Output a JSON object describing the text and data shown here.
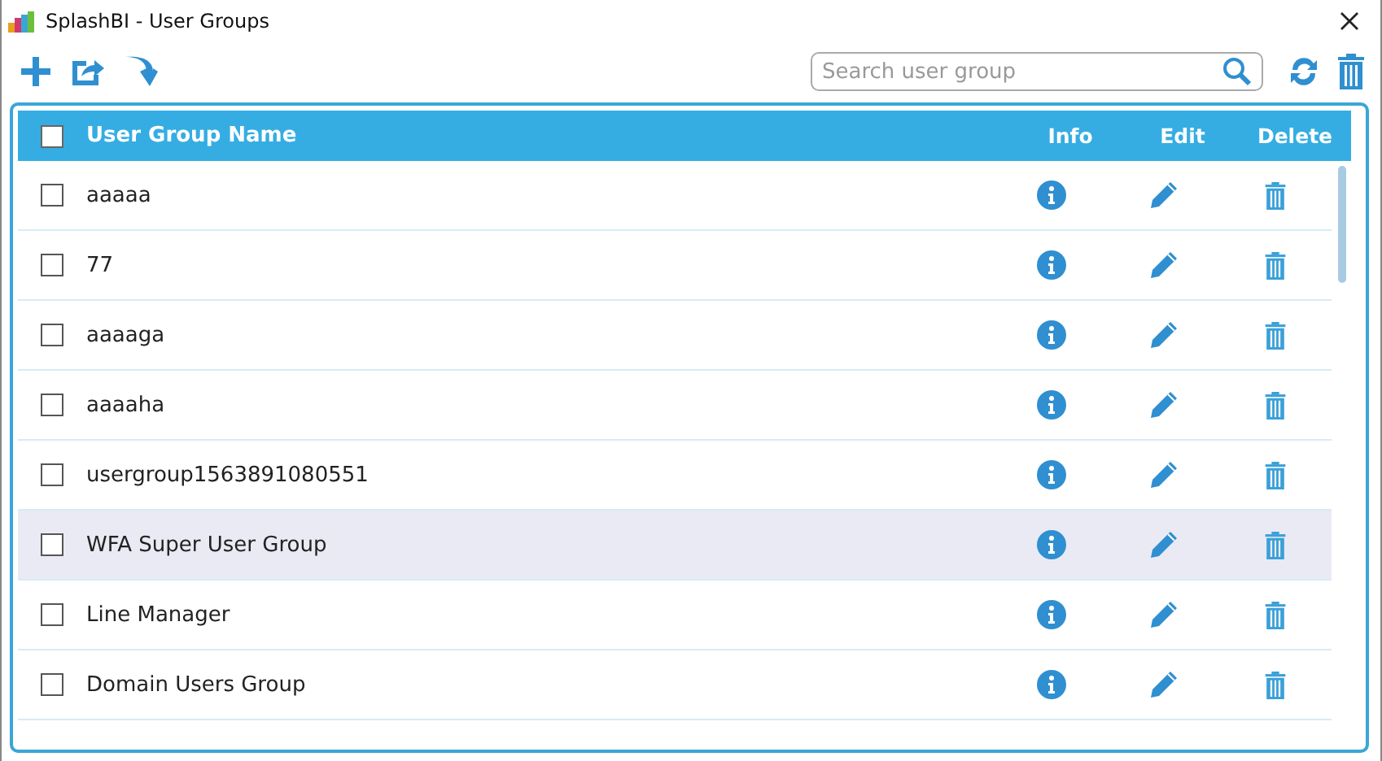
{
  "window": {
    "title": "SplashBI - User Groups"
  },
  "search": {
    "placeholder": "Search user group"
  },
  "table": {
    "select_all_checked": false,
    "columns": [
      "User Group Name",
      "Info",
      "Edit",
      "Delete"
    ],
    "rows": [
      {
        "name": "aaaaa",
        "checked": false,
        "selected": false
      },
      {
        "name": "77",
        "checked": false,
        "selected": false
      },
      {
        "name": "aaaaga",
        "checked": false,
        "selected": false
      },
      {
        "name": "aaaaha",
        "checked": false,
        "selected": false
      },
      {
        "name": "usergroup1563891080551",
        "checked": false,
        "selected": false
      },
      {
        "name": "WFA Super User Group",
        "checked": false,
        "selected": true
      },
      {
        "name": "Line Manager",
        "checked": false,
        "selected": false
      },
      {
        "name": "Domain Users Group",
        "checked": false,
        "selected": false
      }
    ]
  }
}
